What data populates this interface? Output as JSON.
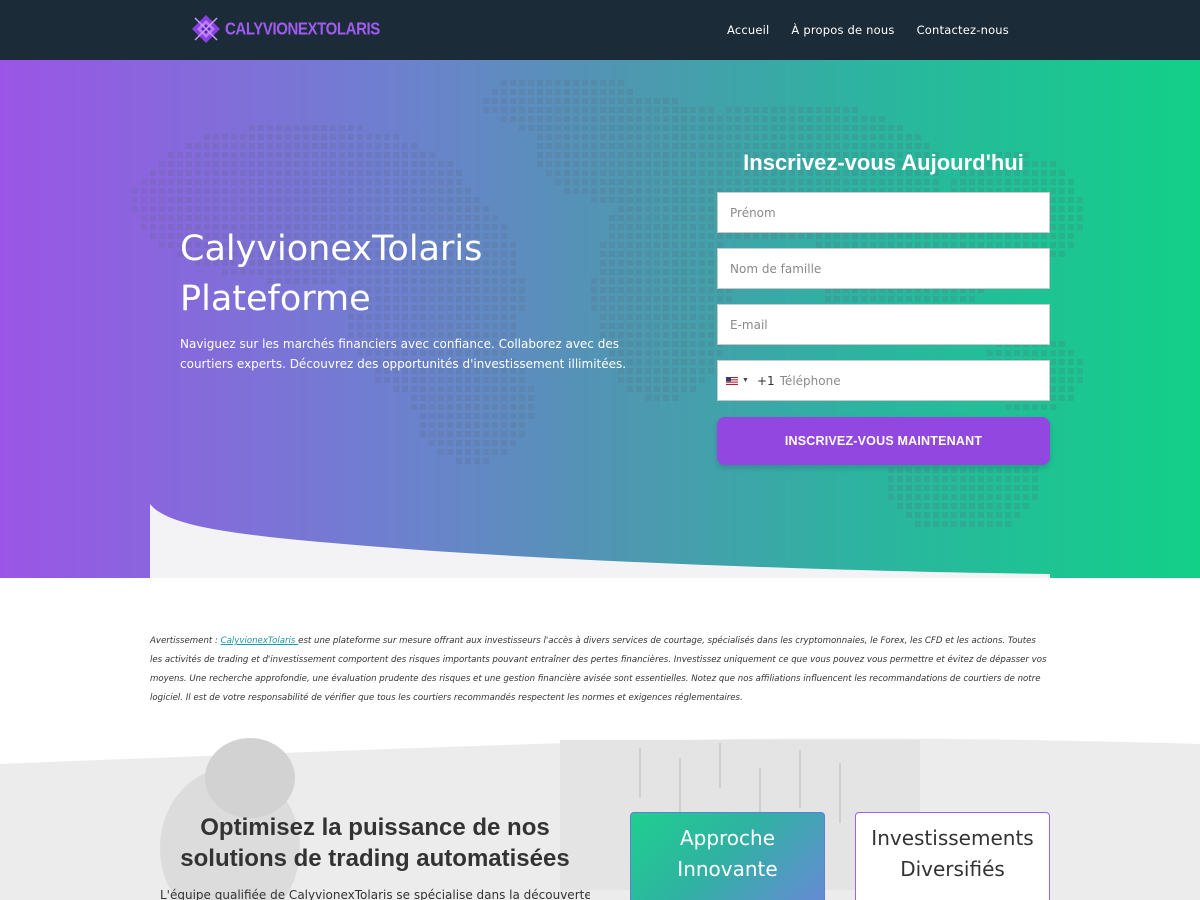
{
  "header": {
    "logo_text": "CALYVIONEXTOLARIS",
    "nav": [
      "Accueil",
      "À propos de nous",
      "Contactez-nous"
    ]
  },
  "hero": {
    "title_line1": "CalyvionexTolaris",
    "title_line2": "Plateforme",
    "subtitle": "Naviguez sur les marchés financiers avec confiance. Collaborez avec des courtiers experts. Découvrez des opportunités d'investissement illimitées."
  },
  "form": {
    "title": "Inscrivez-vous Aujourd'hui",
    "first_name_placeholder": "Prénom",
    "last_name_placeholder": "Nom de famille",
    "email_placeholder": "E-mail",
    "phone_dial_code": "+1",
    "phone_placeholder": "Téléphone",
    "submit_label": "INSCRIVEZ-VOUS MAINTENANT"
  },
  "disclaimer": {
    "prefix": "Avertissement : ",
    "link_text": "CalyvionexTolaris ",
    "body": "est une plateforme sur mesure offrant aux investisseurs l'accès à divers services de courtage, spécialisés dans les cryptomonnaies, le Forex, les CFD et les actions. Toutes les activités de trading et d'investissement comportent des risques importants pouvant entraîner des pertes financières. Investissez uniquement ce que vous pouvez vous permettre et évitez de dépasser vos moyens. Une recherche approfondie, une évaluation prudente des risques et une gestion financière avisée sont essentielles. Notez que nos affiliations influencent les recommandations de courtiers de notre logiciel. Il est de votre responsabilité de vérifier que tous les courtiers recommandés respectent les normes et exigences réglementaires."
  },
  "section2": {
    "title_line1": "Optimisez la puissance de nos",
    "title_line2": "solutions de trading automatisées",
    "paragraph": "L'équipe qualifiée de CalyvionexTolaris se spécialise dans la découverte de",
    "cards": [
      {
        "line1": "Approche",
        "line2": "Innovante"
      },
      {
        "line1": "Investissements",
        "line2": "Diversifiés"
      }
    ]
  },
  "colors": {
    "header_bg": "#1b2b38",
    "brand_purple": "#9248e0",
    "gradient_start": "#9b55e6",
    "gradient_end": "#12d088"
  },
  "icons": [
    "logo-diamond-icon",
    "us-flag-icon",
    "caret-down-icon"
  ]
}
